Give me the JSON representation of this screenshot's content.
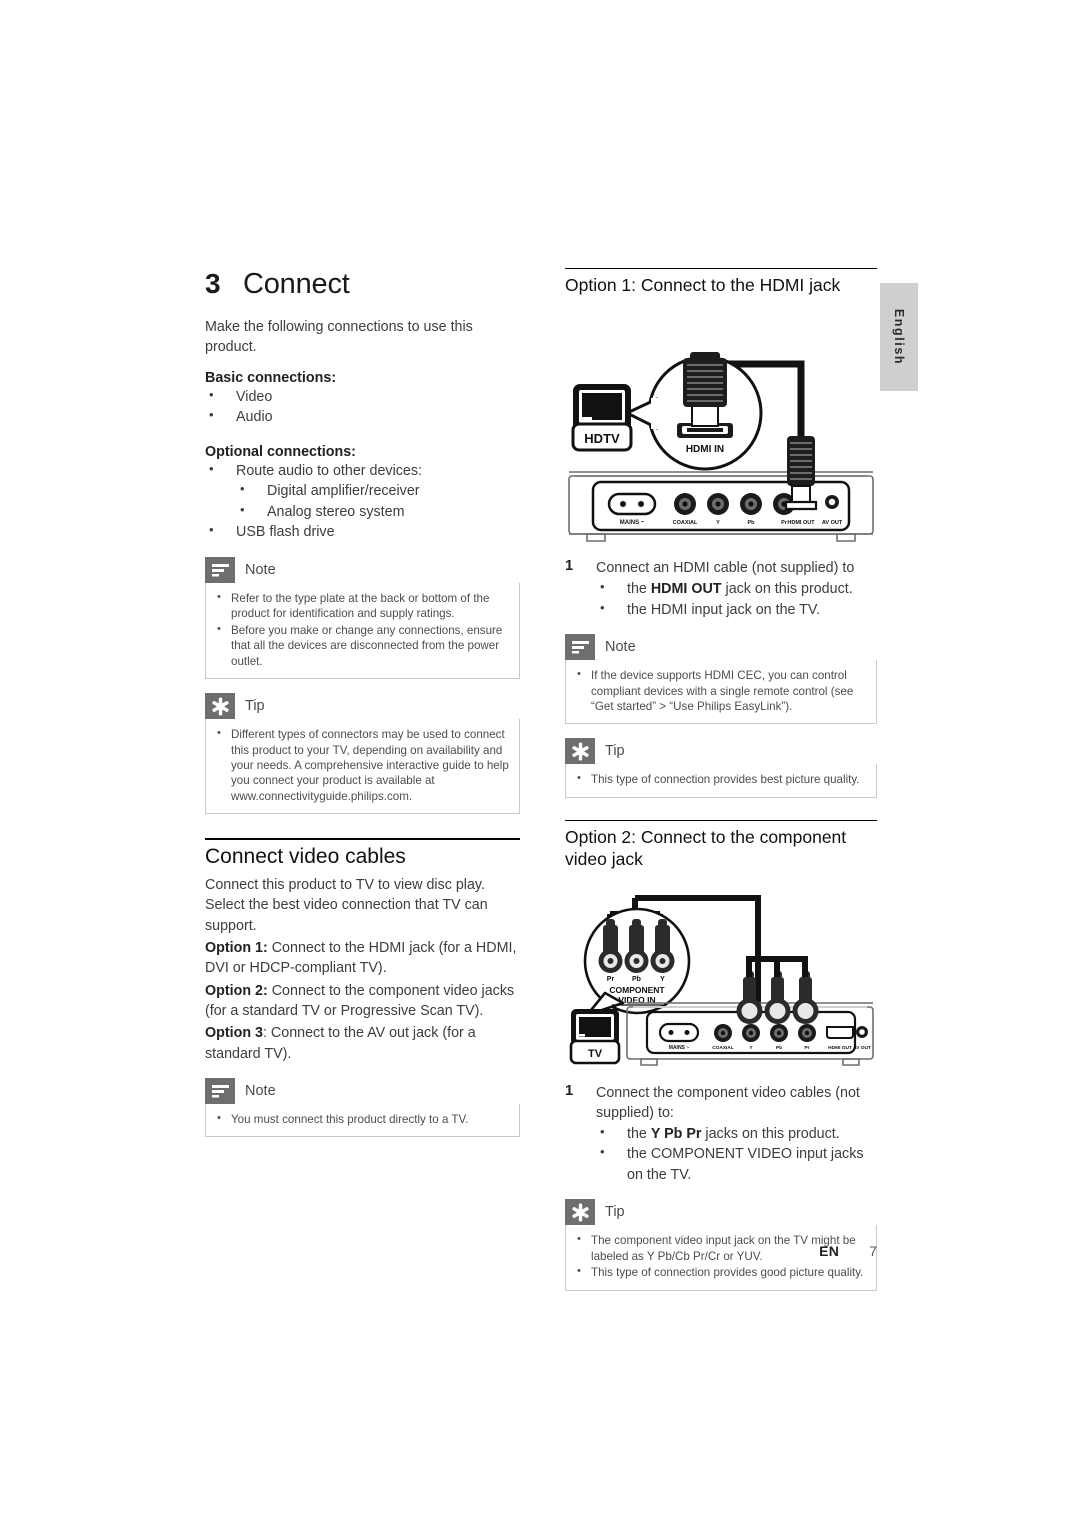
{
  "chapter": {
    "number": "3",
    "title": "Connect"
  },
  "intro": "Make the following connections to use this product.",
  "basic": {
    "heading": "Basic connections:",
    "items": [
      "Video",
      "Audio"
    ]
  },
  "optional": {
    "heading": "Optional connections:",
    "items": [
      "Route audio to other devices:",
      "USB flash drive"
    ],
    "sub_items": [
      "Digital amplifier/receiver",
      "Analog stereo system"
    ]
  },
  "note1": {
    "title": "Note",
    "items": [
      "Refer to the type plate at the back or bottom of the product for identification and supply ratings.",
      "Before you make or change any connections, ensure that all the devices are disconnected from the power outlet."
    ]
  },
  "tip1": {
    "title": "Tip",
    "items": [
      "Different types of connectors may be used to connect this product to your TV, depending on availability and your needs. A comprehensive interactive guide to help you connect your product is available at www.connectivityguide.philips.com."
    ]
  },
  "video_cables": {
    "heading": "Connect video cables",
    "para1": "Connect this product to TV to view disc play. Select the best video connection that TV can support.",
    "opt1_label": "Option 1:",
    "opt1_text": " Connect to the HDMI jack (for a HDMI, DVI or HDCP-compliant TV).",
    "opt2_label": "Option 2:",
    "opt2_text": " Connect to the component video jacks (for a standard TV or Progressive Scan TV).",
    "opt3_label": "Option 3",
    "opt3_text": ": Connect to the AV out jack (for a standard TV)."
  },
  "note2": {
    "title": "Note",
    "items": [
      "You must connect this product directly to a TV."
    ]
  },
  "option1": {
    "heading": "Option 1: Connect to the HDMI jack",
    "step_number": "1",
    "step_text": "Connect an HDMI cable (not supplied) to",
    "bullet1_pre": "the ",
    "bullet1_bold": "HDMI OUT",
    "bullet1_post": " jack on this product.",
    "bullet2": "the HDMI input jack on the TV.",
    "diagram": {
      "tv_label": "HDTV",
      "callout_label": "HDMI IN",
      "panel_labels": [
        "MAINS ~",
        "COAXIAL",
        "Y",
        "Pb",
        "Pr",
        "HDMI OUT",
        "AV OUT"
      ]
    }
  },
  "note3": {
    "title": "Note",
    "items": [
      "If the device supports HDMI CEC, you can control compliant devices with a single remote control (see “Get started” > “Use Philips EasyLink”)."
    ]
  },
  "tip2": {
    "title": "Tip",
    "items": [
      "This type of connection provides best picture quality."
    ]
  },
  "option2": {
    "heading": "Option 2: Connect to the component video jack",
    "step_number": "1",
    "step_text": "Connect the component video cables (not supplied) to:",
    "bullet1_pre": "the ",
    "bullet1_bold": "Y Pb Pr",
    "bullet1_post": " jacks on this product.",
    "bullet2": "the COMPONENT VIDEO input jacks on the TV.",
    "diagram": {
      "tv_label": "TV",
      "callout_line1": "COMPONENT",
      "callout_line2": "VIDEO IN",
      "plug_labels": [
        "Pr",
        "Pb",
        "Y"
      ],
      "panel_labels": [
        "MAINS ~",
        "COAXIAL",
        "Y",
        "Pb",
        "Pr",
        "HDMI OUT",
        "AV OUT"
      ]
    }
  },
  "tip3": {
    "title": "Tip",
    "items": [
      "The component video input jack on the TV might be labeled as Y Pb/Cb Pr/Cr or YUV.",
      "This type of connection provides good picture quality."
    ]
  },
  "sidebar": {
    "language": "English"
  },
  "footer": {
    "lang_code": "EN",
    "page_number": "7"
  },
  "colors": {
    "callout_icon_bg": "#6e6e6e",
    "callout_border": "#c9c9c9",
    "lang_tab_bg": "#cfcfcf",
    "text": "#3d3d3d",
    "heading": "#111111"
  }
}
